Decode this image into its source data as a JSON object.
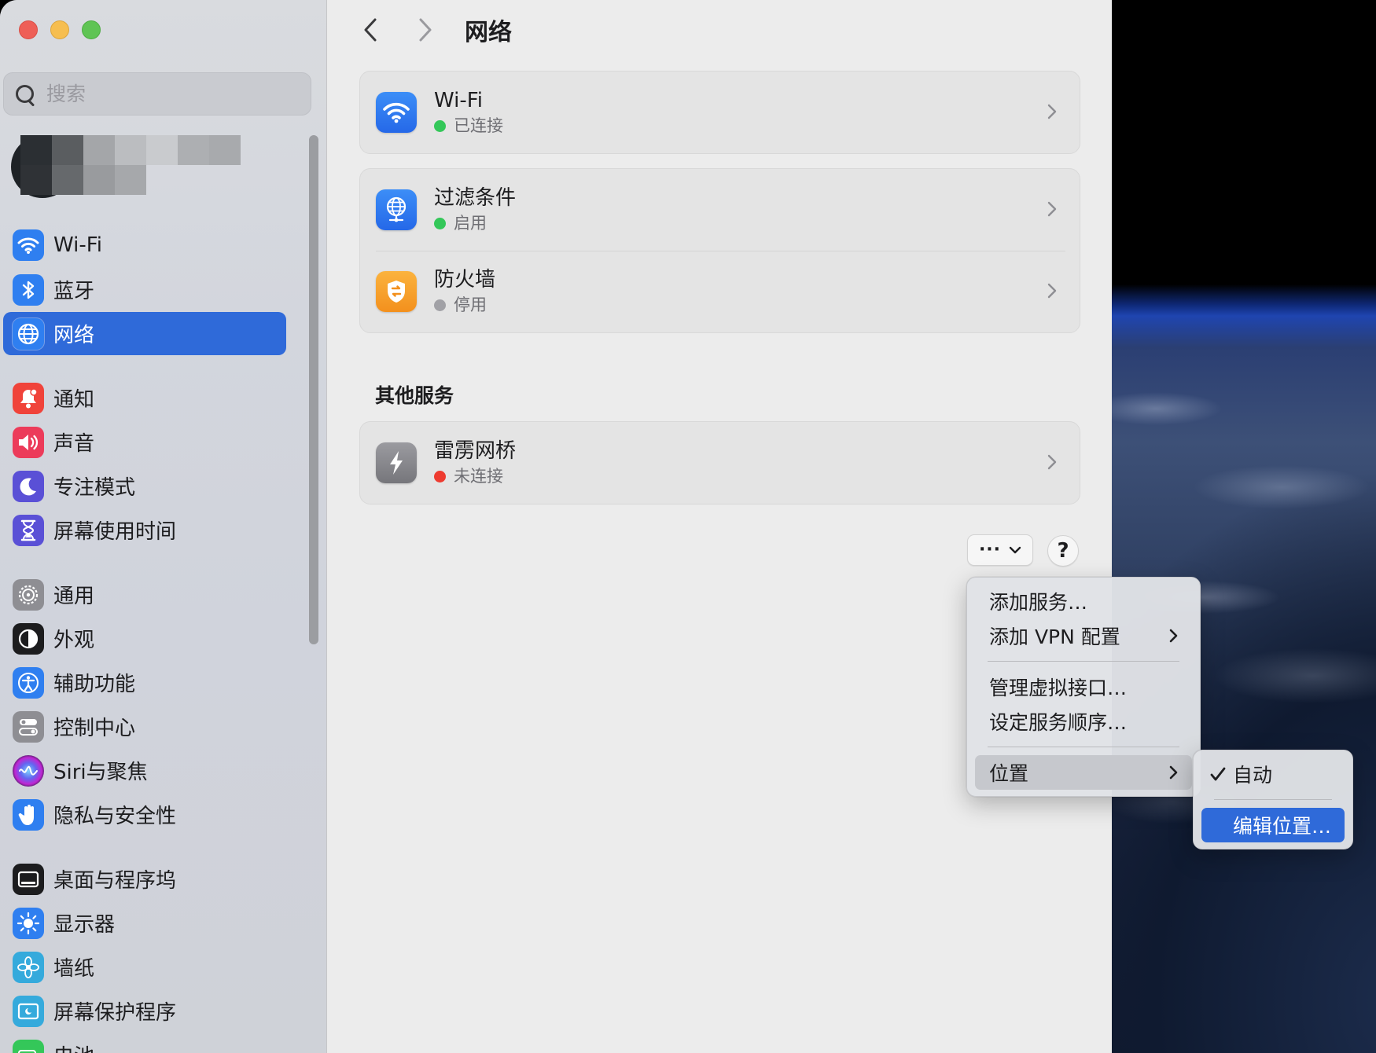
{
  "window": {
    "title": "网络"
  },
  "sidebar": {
    "search_placeholder": "搜索",
    "items": [
      {
        "label": "Wi-Fi",
        "icon": "wifi-icon",
        "color": "#2f7ff0"
      },
      {
        "label": "蓝牙",
        "icon": "bluetooth-icon",
        "color": "#2f7ff0"
      },
      {
        "label": "网络",
        "icon": "globe-icon",
        "color": "#2f7ff0",
        "active": true
      },
      {
        "label": "通知",
        "icon": "bell-icon",
        "color": "#f0433a"
      },
      {
        "label": "声音",
        "icon": "speaker-icon",
        "color": "#ec3b5a"
      },
      {
        "label": "专注模式",
        "icon": "moon-icon",
        "color": "#5a50d6"
      },
      {
        "label": "屏幕使用时间",
        "icon": "hourglass-icon",
        "color": "#5a50d6"
      },
      {
        "label": "通用",
        "icon": "gear-icon",
        "color": "#8e8e93"
      },
      {
        "label": "外观",
        "icon": "appearance-icon",
        "color": "#1c1c1e"
      },
      {
        "label": "辅助功能",
        "icon": "accessibility-icon",
        "color": "#2f7ff0"
      },
      {
        "label": "控制中心",
        "icon": "toggles-icon",
        "color": "#8e8e93"
      },
      {
        "label": "Siri与聚焦",
        "icon": "siri-icon",
        "color": "#3a3a5c"
      },
      {
        "label": "隐私与安全性",
        "icon": "hand-icon",
        "color": "#2f7ff0"
      },
      {
        "label": "桌面与程序坞",
        "icon": "dock-icon",
        "color": "#1c1c1e"
      },
      {
        "label": "显示器",
        "icon": "sun-icon",
        "color": "#2f7ff0"
      },
      {
        "label": "墙纸",
        "icon": "flower-icon",
        "color": "#35aadc"
      },
      {
        "label": "屏幕保护程序",
        "icon": "screensaver-icon",
        "color": "#35aadc"
      },
      {
        "label": "电池",
        "icon": "battery-icon",
        "color": "#34c759"
      }
    ]
  },
  "main": {
    "title": "网络",
    "services": [
      {
        "name": "Wi-Fi",
        "status": "已连接",
        "status_color": "#34c759",
        "icon": "wifi-icon"
      }
    ],
    "filters": [
      {
        "name": "过滤条件",
        "status": "启用",
        "status_color": "#34c759",
        "icon": "filter-globe-icon"
      },
      {
        "name": "防火墙",
        "status": "停用",
        "status_color": "#a1a1a6",
        "icon": "firewall-shield-icon"
      }
    ],
    "other_section_title": "其他服务",
    "other_services": [
      {
        "name": "雷雳网桥",
        "status": "未连接",
        "status_color": "#ee3b30",
        "icon": "thunderbolt-icon"
      }
    ],
    "more_button": "···",
    "help_button": "?"
  },
  "menu": {
    "items": [
      {
        "label": "添加服务…"
      },
      {
        "label": "添加 VPN 配置",
        "submenu": true
      },
      {
        "label": "管理虚拟接口…"
      },
      {
        "label": "设定服务顺序…"
      },
      {
        "label": "位置",
        "submenu": true
      }
    ]
  },
  "submenu": {
    "items": [
      {
        "label": "自动",
        "checked": true
      },
      {
        "label": "编辑位置…"
      }
    ]
  },
  "colors": {
    "accent": "#2f6ad9"
  }
}
